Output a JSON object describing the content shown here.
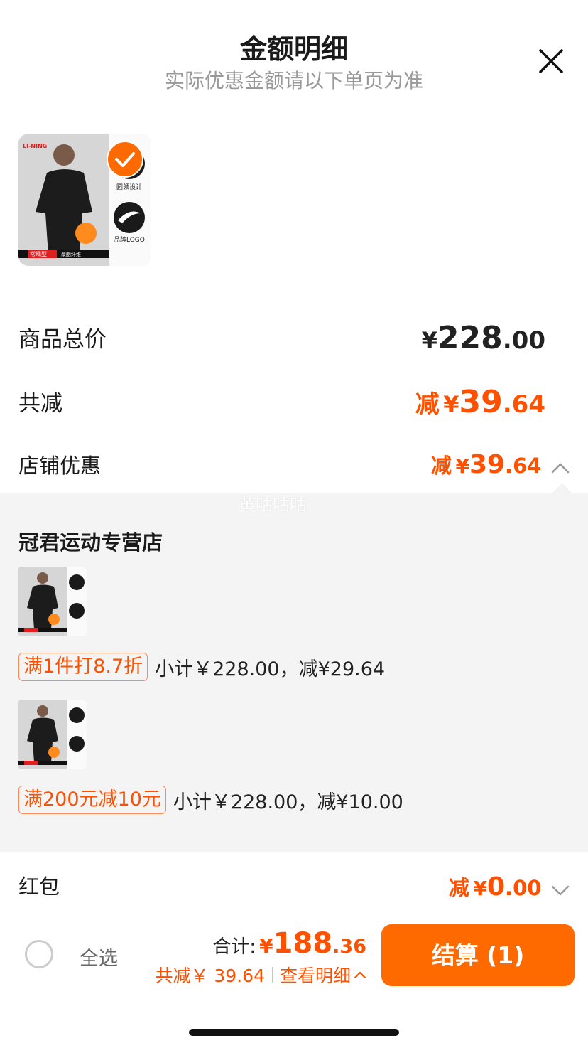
{
  "header": {
    "title": "金额明细",
    "subtitle": "实际优惠金额请以下单页为准"
  },
  "product_image": {
    "brand": "LI-NING",
    "badge_left": "常规型",
    "badge_right": "聚酯纤维",
    "feature_1": "圆领设计",
    "feature_2": "品牌LOGO"
  },
  "summary": {
    "total_label": "商品总价",
    "total_currency": "¥",
    "total_int": "228",
    "total_dec": ".00",
    "discount_label": "共减",
    "discount_prefix": "减",
    "discount_currency": "¥",
    "discount_int": "39",
    "discount_dec": ".64",
    "store_label": "店铺优惠",
    "store_prefix": "减",
    "store_currency": "¥",
    "store_int": "39",
    "store_dec": ".64"
  },
  "watermark": "黄咕咕咕",
  "store_detail": {
    "name": "冠君运动专营店",
    "promos": [
      {
        "tag": "满1件打8.7折",
        "text": "小计￥228.00，减¥29.64"
      },
      {
        "tag": "满200元减10元",
        "text": "小计￥228.00，减¥10.00"
      }
    ]
  },
  "red_packet": {
    "label": "红包",
    "prefix": "减",
    "currency": "¥",
    "int": "0",
    "dec": ".00"
  },
  "footer": {
    "select_all": "全选",
    "total_label": "合计:",
    "total_currency": "¥",
    "total_int": "188",
    "total_dec": ".36",
    "discount_text": "共减￥ 39.64",
    "detail_link": "查看明细",
    "checkout_label": "结算 (1)"
  },
  "colors": {
    "accent": "#ff5000",
    "checkout_bg": "#ff6a00"
  }
}
